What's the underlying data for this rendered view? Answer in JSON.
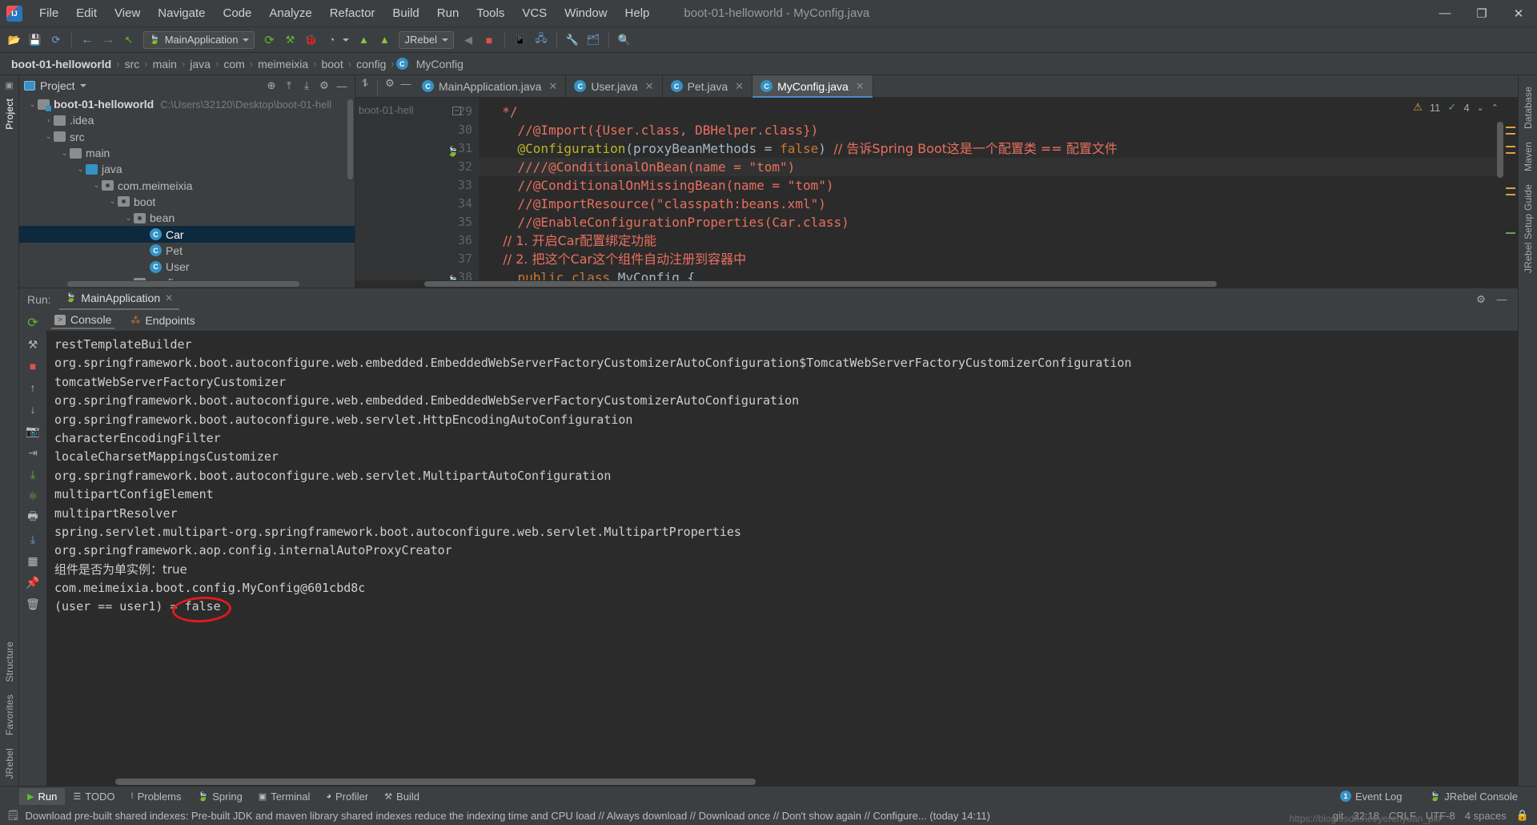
{
  "titlebar": {
    "menus": [
      "File",
      "Edit",
      "View",
      "Navigate",
      "Code",
      "Analyze",
      "Refactor",
      "Build",
      "Run",
      "Tools",
      "VCS",
      "Window",
      "Help"
    ],
    "window_title": "boot-01-helloworld - MyConfig.java",
    "minimize": "—",
    "maximize": "❐",
    "close": "✕",
    "logo_icon": "intellij-idea-logo"
  },
  "toolbar": {
    "run_config_label": "MainApplication",
    "jrebel_label": "JRebel",
    "icons": [
      "open-project-icon",
      "save-all-icon",
      "sync-icon",
      "back-icon",
      "forward-icon",
      "pointer-icon",
      "rerun-icon",
      "debug-icon",
      "coverage-icon",
      "profile-icon",
      "jrebel-run-icon",
      "jrebel-debug-icon",
      "stop-icon-left",
      "stop-icon",
      "device-manager-icon",
      "avd-manager-icon",
      "settings-icon",
      "project-structure-icon",
      "search-everywhere-icon"
    ]
  },
  "breadcrumb": {
    "items": [
      "boot-01-helloworld",
      "src",
      "main",
      "java",
      "com",
      "meimeixia",
      "boot",
      "config",
      "MyConfig"
    ],
    "separator": "›",
    "class_badge": "C"
  },
  "left_strip": {
    "items": [
      "Project",
      "Structure",
      "Favorites",
      "JRebel"
    ]
  },
  "right_strip": {
    "items": [
      "Database",
      "Maven",
      "JRebel Setup Guide"
    ]
  },
  "project_panel": {
    "title": "Project",
    "actions": [
      "locate-icon",
      "expand-all-icon",
      "collapse-all-icon",
      "settings-icon",
      "hide-icon"
    ],
    "tree": [
      {
        "depth": 0,
        "chevron": "⌄",
        "icon": "module",
        "label": "boot-01-helloworld",
        "bold": true,
        "path": "C:\\Users\\32120\\Desktop\\boot-01-hell",
        "selected": false
      },
      {
        "depth": 1,
        "chevron": "›",
        "icon": "folder",
        "label": ".idea",
        "bold": false,
        "path": "",
        "selected": false
      },
      {
        "depth": 1,
        "chevron": "⌄",
        "icon": "folder",
        "label": "src",
        "bold": false,
        "path": "",
        "selected": false
      },
      {
        "depth": 2,
        "chevron": "⌄",
        "icon": "folder",
        "label": "main",
        "bold": false,
        "path": "",
        "selected": false
      },
      {
        "depth": 3,
        "chevron": "⌄",
        "icon": "source",
        "label": "java",
        "bold": false,
        "path": "",
        "selected": false
      },
      {
        "depth": 4,
        "chevron": "⌄",
        "icon": "package",
        "label": "com.meimeixia",
        "bold": false,
        "path": "",
        "selected": false
      },
      {
        "depth": 5,
        "chevron": "⌄",
        "icon": "package",
        "label": "boot",
        "bold": false,
        "path": "",
        "selected": false
      },
      {
        "depth": 6,
        "chevron": "⌄",
        "icon": "package",
        "label": "bean",
        "bold": false,
        "path": "",
        "selected": false
      },
      {
        "depth": 7,
        "chevron": "",
        "icon": "class",
        "label": "Car",
        "bold": false,
        "path": "",
        "selected": true
      },
      {
        "depth": 7,
        "chevron": "",
        "icon": "class",
        "label": "Pet",
        "bold": false,
        "path": "",
        "selected": false
      },
      {
        "depth": 7,
        "chevron": "",
        "icon": "class",
        "label": "User",
        "bold": false,
        "path": "",
        "selected": false
      },
      {
        "depth": 6,
        "chevron": "⌄",
        "icon": "package",
        "label": "config",
        "bold": false,
        "path": "",
        "selected": false
      }
    ]
  },
  "editor": {
    "tabs": [
      {
        "label": "MainApplication.java",
        "icon": "spring-class-icon",
        "active": false,
        "close": "✕"
      },
      {
        "label": "User.java",
        "icon": "class-icon",
        "active": false,
        "close": "✕"
      },
      {
        "label": "Pet.java",
        "icon": "class-icon",
        "active": false,
        "close": "✕"
      },
      {
        "label": "MyConfig.java",
        "icon": "class-icon",
        "active": true,
        "close": "✕"
      }
    ],
    "tab_actions": [
      "collapse-icon",
      "settings-icon",
      "minimize-icon"
    ],
    "breadcrumb_left": "boot-01-hell",
    "inspection": {
      "warnings": "11",
      "checks": "4",
      "warn_icon": "warning-triangle-icon",
      "check_icon": "checkmark-icon"
    },
    "lines": [
      {
        "num": "29",
        "marker": "fold-icon",
        "highlight": false,
        "tokens": [
          {
            "t": "  */",
            "c": "cm"
          }
        ]
      },
      {
        "num": "30",
        "marker": "",
        "highlight": false,
        "tokens": [
          {
            "t": "    //@Import({User.class, DBHelper.class})",
            "c": "cm"
          }
        ]
      },
      {
        "num": "31",
        "marker": "spring-bean-icon",
        "highlight": false,
        "tokens": [
          {
            "t": "    ",
            "c": "id"
          },
          {
            "t": "@Configuration",
            "c": "ann"
          },
          {
            "t": "(",
            "c": "par"
          },
          {
            "t": "proxyBeanMethods",
            "c": "id"
          },
          {
            "t": " = ",
            "c": "par"
          },
          {
            "t": "false",
            "c": "kw"
          },
          {
            "t": ") ",
            "c": "par"
          },
          {
            "t": "// 告诉Spring Boot这是一个配置类 == 配置文件",
            "c": "cm"
          }
        ]
      },
      {
        "num": "32",
        "marker": "",
        "highlight": true,
        "tokens": [
          {
            "t": "    ////@ConditionalOnBean(name = \"tom\")",
            "c": "cm"
          }
        ]
      },
      {
        "num": "33",
        "marker": "",
        "highlight": false,
        "tokens": [
          {
            "t": "    //@ConditionalOnMissingBean(name = \"tom\")",
            "c": "cm"
          }
        ]
      },
      {
        "num": "34",
        "marker": "",
        "highlight": false,
        "tokens": [
          {
            "t": "    //@ImportResource(\"classpath:beans.xml\")",
            "c": "cm"
          }
        ]
      },
      {
        "num": "35",
        "marker": "",
        "highlight": false,
        "tokens": [
          {
            "t": "    //@EnableConfigurationProperties(Car.class)",
            "c": "cm"
          }
        ]
      },
      {
        "num": "36",
        "marker": "",
        "highlight": false,
        "tokens": [
          {
            "t": "    // 1. 开启Car配置绑定功能",
            "c": "cm"
          }
        ]
      },
      {
        "num": "37",
        "marker": "",
        "highlight": false,
        "tokens": [
          {
            "t": "    // 2. 把这个Car这个组件自动注册到容器中",
            "c": "cm"
          }
        ]
      },
      {
        "num": "38",
        "marker": "spring-bean-icon",
        "highlight": false,
        "tokens": [
          {
            "t": "    ",
            "c": "id"
          },
          {
            "t": "public class ",
            "c": "kw"
          },
          {
            "t": "MyConfig ",
            "c": "id"
          },
          {
            "t": "{",
            "c": "par"
          }
        ]
      }
    ]
  },
  "run_panel": {
    "header_label": "Run:",
    "config_name": "MainApplication",
    "config_close": "✕",
    "header_actions": [
      "settings-icon",
      "minimize-icon"
    ],
    "left_tools": [
      "rerun-icon",
      "build-icon",
      "stop-icon",
      "up-icon",
      "down-icon",
      "camera-icon",
      "soft-wrap-icon",
      "scroll-to-end-icon",
      "thread-dump-icon",
      "print-icon",
      "export-icon",
      "layout-icon",
      "pin-icon",
      "trash-icon"
    ],
    "subtabs": [
      {
        "label": "Console",
        "icon": "console-icon",
        "active": true
      },
      {
        "label": "Endpoints",
        "icon": "endpoints-icon",
        "active": false
      }
    ],
    "console_lines": [
      "restTemplateBuilder",
      "org.springframework.boot.autoconfigure.web.embedded.EmbeddedWebServerFactoryCustomizerAutoConfiguration$TomcatWebServerFactoryCustomizerConfiguration",
      "tomcatWebServerFactoryCustomizer",
      "org.springframework.boot.autoconfigure.web.embedded.EmbeddedWebServerFactoryCustomizerAutoConfiguration",
      "org.springframework.boot.autoconfigure.web.servlet.HttpEncodingAutoConfiguration",
      "characterEncodingFilter",
      "localeCharsetMappingsCustomizer",
      "org.springframework.boot.autoconfigure.web.servlet.MultipartAutoConfiguration",
      "multipartConfigElement",
      "multipartResolver",
      "spring.servlet.multipart-org.springframework.boot.autoconfigure.web.servlet.MultipartProperties",
      "org.springframework.aop.config.internalAutoProxyCreator",
      "组件是否为单实例：true",
      "com.meimeixia.boot.config.MyConfig@601cbd8c",
      "(user == user1) = false"
    ],
    "annotation": {
      "shape": "red-ellipse",
      "color": "#e01b1b",
      "target_text": "false"
    }
  },
  "status_bar": {
    "tools": [
      {
        "label": "Run",
        "icon": "run-icon",
        "active": true
      },
      {
        "label": "TODO",
        "icon": "todo-icon",
        "active": false
      },
      {
        "label": "Problems",
        "icon": "problems-icon",
        "active": false
      },
      {
        "label": "Spring",
        "icon": "spring-icon",
        "active": false
      },
      {
        "label": "Terminal",
        "icon": "terminal-icon",
        "active": false
      },
      {
        "label": "Profiler",
        "icon": "profiler-icon",
        "active": false
      },
      {
        "label": "Build",
        "icon": "build-icon",
        "active": false
      }
    ],
    "right": [
      {
        "label": "Event Log",
        "icon": "event-log-icon",
        "badge": "1"
      },
      {
        "label": "JRebel Console",
        "icon": "jrebel-icon",
        "badge": ""
      }
    ],
    "message": "Download pre-built shared indexes: Pre-built JDK and maven library shared indexes reduce the indexing time and CPU load // Always download // Download once // Don't show again // Configure... (today 14:11)",
    "message_icon": "indexes-icon",
    "position": "32:18",
    "line_sep": "CRLF",
    "encoding": "UTF-8",
    "indent": "4 spaces",
    "branch": "git",
    "lock_icon": "lock-icon"
  },
  "watermark": "https://blog.csdn.net/yerenyuan_pkf"
}
